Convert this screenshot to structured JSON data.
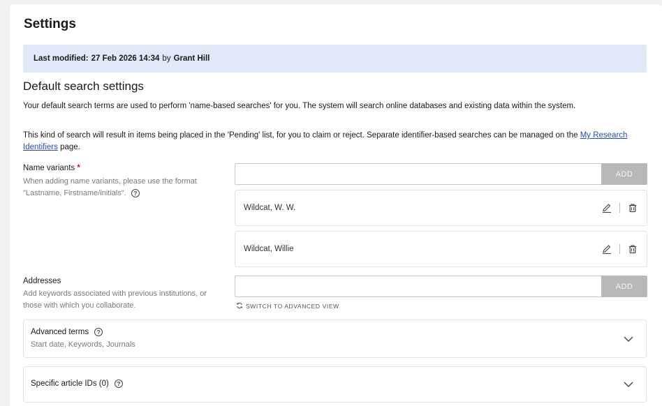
{
  "page": {
    "title": "Settings"
  },
  "modified": {
    "prefix": "Last modified:",
    "datetime": "27 Feb 2026 14:34",
    "by": "by",
    "user": "Grant Hill"
  },
  "default_search": {
    "title": "Default search settings",
    "para1": "Your default search terms are used to perform 'name-based searches' for you. The system will search online databases and existing data within the system.",
    "para2_before": "This kind of search will result in items being placed in the 'Pending' list, for you to claim or reject. Separate identifier-based searches can be managed on the",
    "para2_link": "My Research Identifiers",
    "para2_after": "page."
  },
  "name_variants": {
    "label": "Name variants",
    "required_mark": "*",
    "help": "When adding name variants, please use the format \"Lastname, Firstname/initials\".",
    "input_value": "",
    "add_label": "ADD",
    "items": [
      {
        "name": "Wildcat, W. W."
      },
      {
        "name": "Wildcat, Willie"
      }
    ]
  },
  "addresses": {
    "label": "Addresses",
    "help": "Add keywords associated with previous institutions, or those with which you collaborate.",
    "input_value": "",
    "add_label": "ADD",
    "switch_label": "SWITCH TO ADVANCED VIEW"
  },
  "advanced_terms": {
    "title": "Advanced terms",
    "subtitle": "Start date, Keywords, Journals"
  },
  "article_ids": {
    "title": "Specific article IDs (0)"
  },
  "icons": {
    "help": "help-circle-icon",
    "edit": "pencil-icon",
    "delete": "trash-icon",
    "refresh": "refresh-icon",
    "expand": "chevron-down-icon"
  },
  "colors": {
    "banner_bg": "#dfe9f8",
    "link": "#2550b8",
    "required": "#c8102e",
    "add_button": "#b8b8b8"
  }
}
